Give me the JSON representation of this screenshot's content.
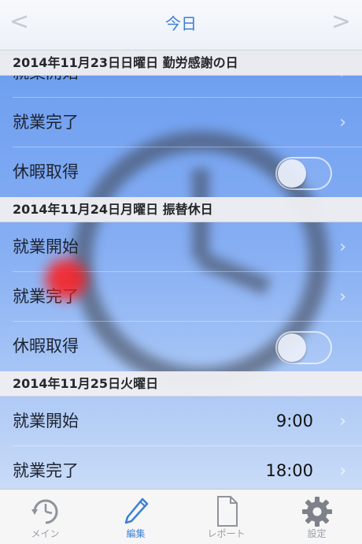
{
  "nav": {
    "title": "今日",
    "prev": "<",
    "next": ">"
  },
  "sections": [
    {
      "header": "2014年11月23日日曜日 勤労感謝の日",
      "rows": {
        "start": "就業開始",
        "end": "就業完了",
        "leave": "休暇取得"
      },
      "leave_on": false
    },
    {
      "header": "2014年11月24日月曜日 振替休日",
      "rows": {
        "start": "就業開始",
        "end": "就業完了",
        "leave": "休暇取得"
      },
      "leave_on": false
    },
    {
      "header": "2014年11月25日火曜日",
      "rows": {
        "start": "就業開始",
        "start_time": "9:00",
        "end": "就業完了",
        "end_time": "18:00"
      }
    }
  ],
  "chevron": "›",
  "tabs": [
    {
      "label": "メイン",
      "icon": "clock-icon"
    },
    {
      "label": "編集",
      "icon": "pencil-icon",
      "active": true
    },
    {
      "label": "レポート",
      "icon": "document-icon"
    },
    {
      "label": "設定",
      "icon": "gear-icon"
    }
  ],
  "colors": {
    "accent": "#3d7fd6",
    "list_background": "#6b9df0",
    "marker": "#ff1a1a"
  }
}
